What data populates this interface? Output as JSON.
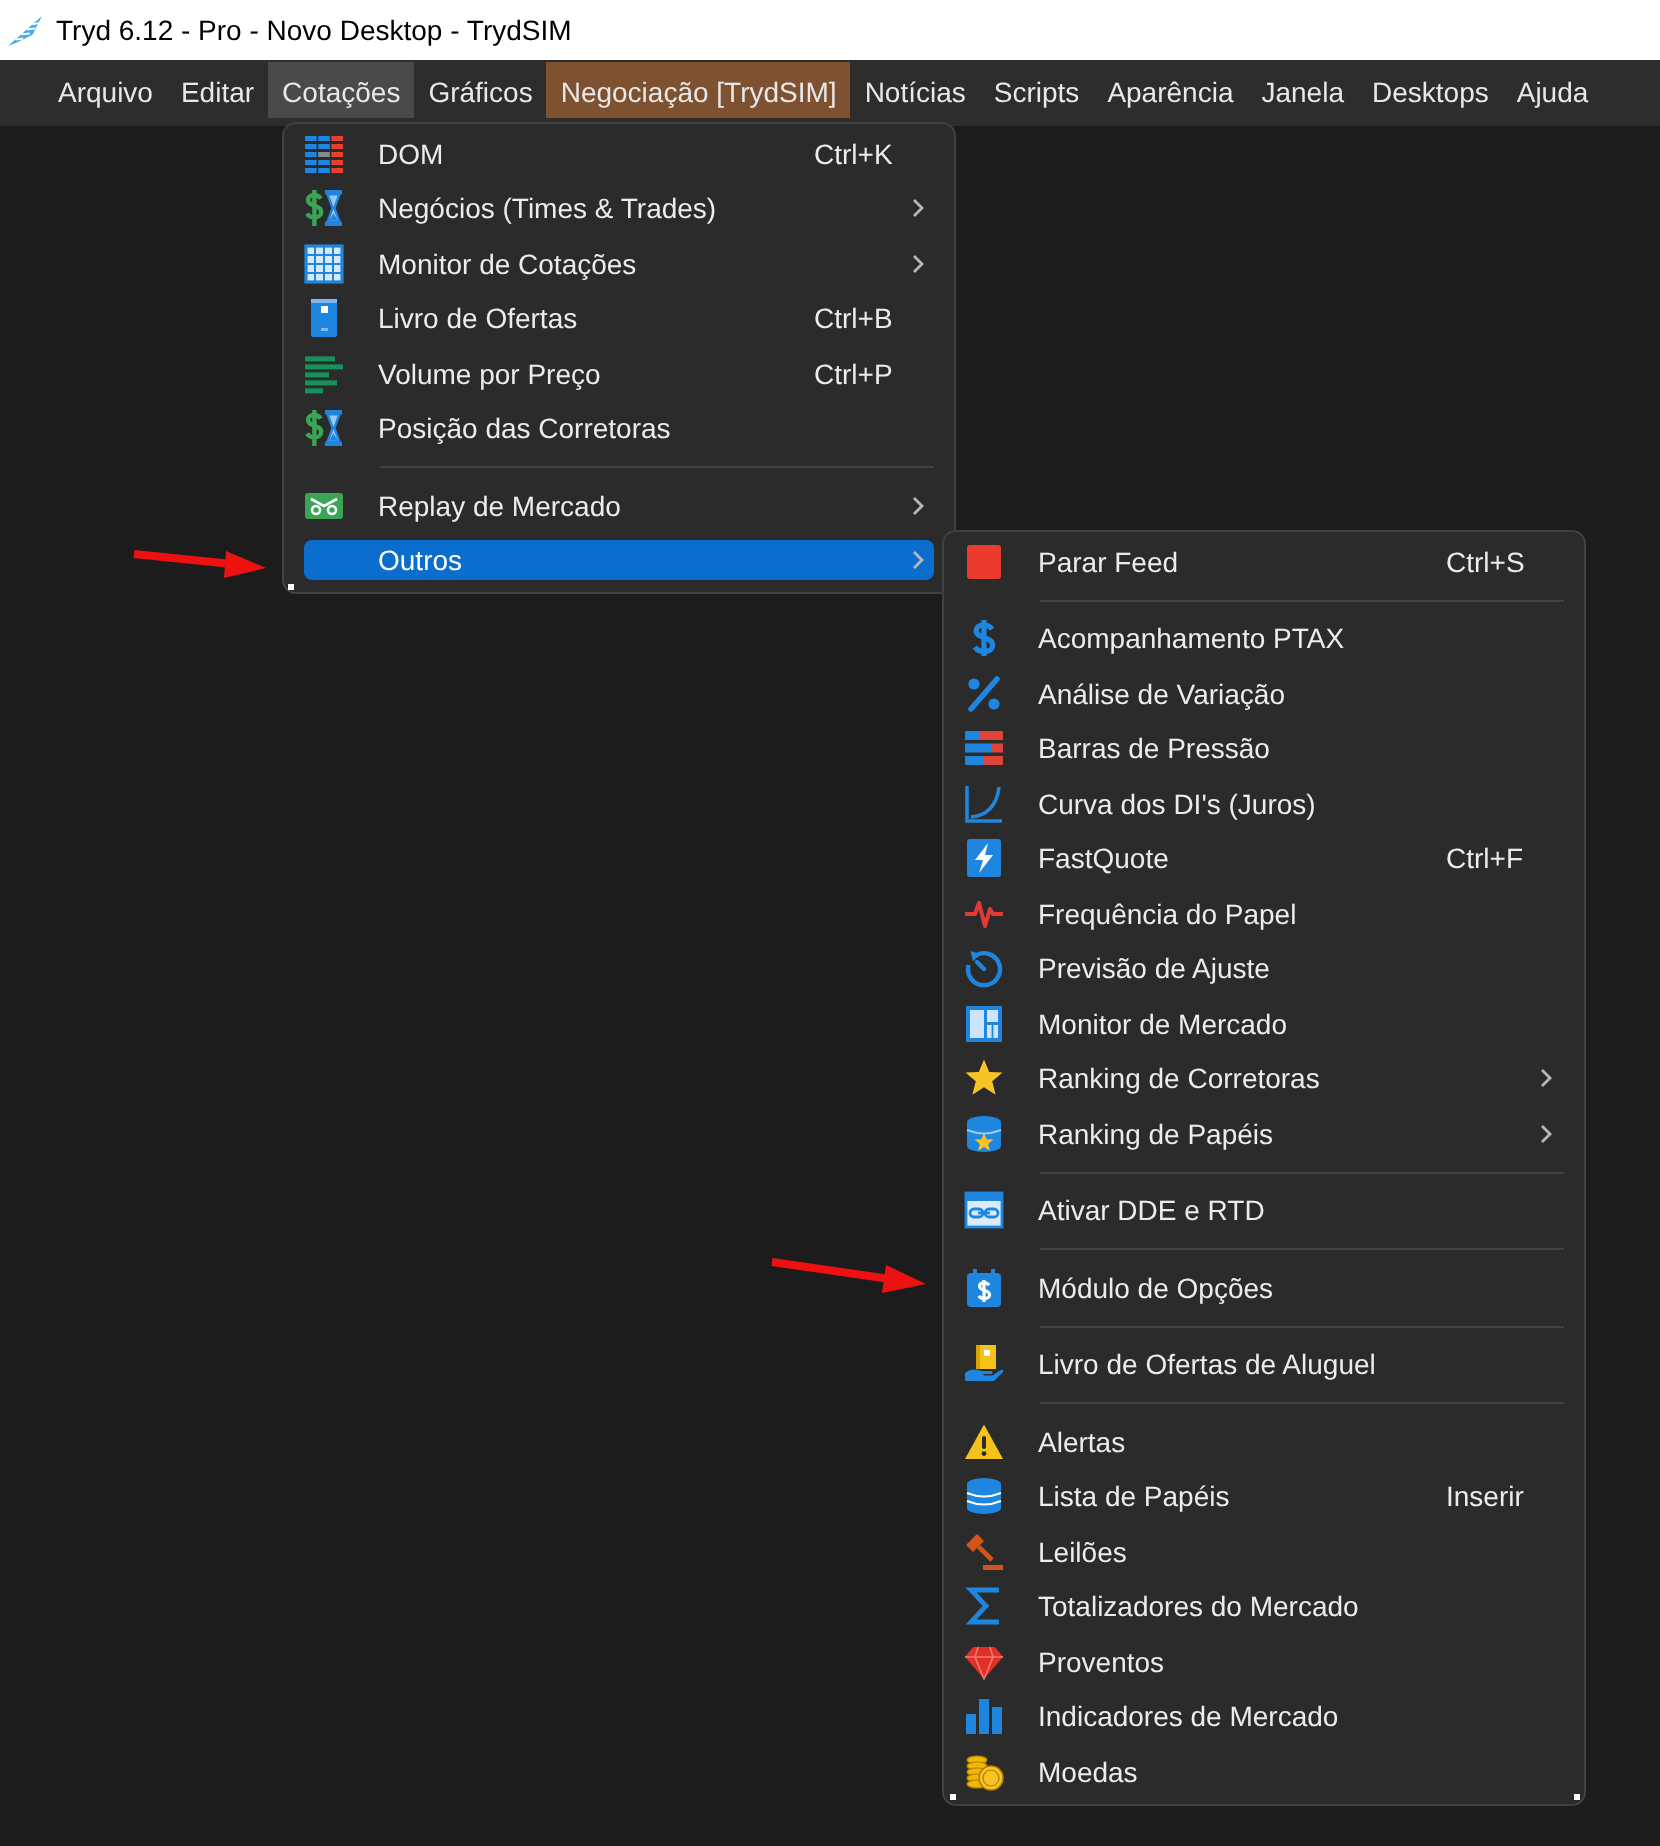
{
  "window": {
    "title": "Tryd 6.12 - Pro - Novo Desktop - TrydSIM"
  },
  "menu_bar": [
    {
      "label": "Arquivo",
      "kind": "normal",
      "selected": false
    },
    {
      "label": "Editar",
      "kind": "normal",
      "selected": false
    },
    {
      "label": "Cotações",
      "kind": "normal",
      "selected": true
    },
    {
      "label": "Gráficos",
      "kind": "normal",
      "selected": false
    },
    {
      "label": "Negociação [TrydSIM]",
      "kind": "accent",
      "selected": false
    },
    {
      "label": "Notícias",
      "kind": "normal",
      "selected": false
    },
    {
      "label": "Scripts",
      "kind": "normal",
      "selected": false
    },
    {
      "label": "Aparência",
      "kind": "normal",
      "selected": false
    },
    {
      "label": "Janela",
      "kind": "normal",
      "selected": false
    },
    {
      "label": "Desktops",
      "kind": "normal",
      "selected": false
    },
    {
      "label": "Ajuda",
      "kind": "normal",
      "selected": false
    }
  ],
  "menu": {
    "groups": [
      {
        "items": [
          {
            "label": "DOM",
            "shortcut": "Ctrl+K",
            "submenu": false,
            "selected": false
          },
          {
            "label": "Negócios (Times & Trades)",
            "submenu": true,
            "selected": false
          },
          {
            "label": "Monitor de Cotações",
            "submenu": true,
            "selected": false
          },
          {
            "label": "Livro de Ofertas",
            "shortcut": "Ctrl+B",
            "submenu": false,
            "selected": false
          },
          {
            "label": "Volume por Preço",
            "shortcut": "Ctrl+P",
            "submenu": false,
            "selected": false
          },
          {
            "label": "Posição das Corretoras",
            "submenu": false,
            "selected": false
          }
        ]
      },
      {
        "items": [
          {
            "label": "Replay de Mercado",
            "submenu": true,
            "selected": false
          },
          {
            "label": "Outros",
            "submenu": true,
            "selected": true
          }
        ]
      }
    ]
  },
  "submenu": {
    "groups": [
      {
        "items": [
          {
            "label": "Parar Feed",
            "shortcut": "Ctrl+S",
            "submenu": false,
            "selected": false
          }
        ]
      },
      {
        "items": [
          {
            "label": "Acompanhamento PTAX",
            "submenu": false,
            "selected": false
          },
          {
            "label": "Análise de Variação",
            "submenu": false,
            "selected": false
          },
          {
            "label": "Barras de Pressão",
            "submenu": false,
            "selected": false
          },
          {
            "label": "Curva dos DI's (Juros)",
            "submenu": false,
            "selected": false
          },
          {
            "label": "FastQuote",
            "shortcut": "Ctrl+F",
            "submenu": false,
            "selected": false
          },
          {
            "label": "Frequência do Papel",
            "submenu": false,
            "selected": false
          },
          {
            "label": "Previsão de Ajuste",
            "submenu": false,
            "selected": false
          },
          {
            "label": "Monitor de Mercado",
            "submenu": false,
            "selected": false
          },
          {
            "label": "Ranking de Corretoras",
            "submenu": true,
            "selected": false
          },
          {
            "label": "Ranking de Papéis",
            "submenu": true,
            "selected": false
          }
        ]
      },
      {
        "items": [
          {
            "label": "Ativar DDE e RTD",
            "submenu": false,
            "selected": false
          }
        ]
      },
      {
        "items": [
          {
            "label": "Módulo de Opções",
            "submenu": false,
            "selected": false
          }
        ]
      },
      {
        "items": [
          {
            "label": "Livro de Ofertas de Aluguel",
            "submenu": false,
            "selected": false
          }
        ]
      },
      {
        "items": [
          {
            "label": "Alertas",
            "submenu": false,
            "selected": false
          },
          {
            "label": "Lista de Papéis",
            "shortcut": "Inserir",
            "submenu": false,
            "selected": false
          },
          {
            "label": "Leilões",
            "submenu": false,
            "selected": false
          },
          {
            "label": "Totalizadores do Mercado",
            "submenu": false,
            "selected": false
          },
          {
            "label": "Proventos",
            "submenu": false,
            "selected": false
          },
          {
            "label": "Indicadores de Mercado",
            "submenu": false,
            "selected": false
          },
          {
            "label": "Moedas",
            "submenu": false,
            "selected": false
          }
        ]
      }
    ]
  }
}
